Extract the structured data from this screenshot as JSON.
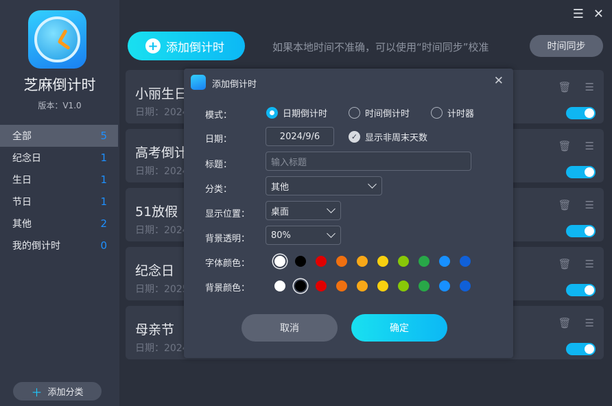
{
  "app": {
    "name": "芝麻倒计时",
    "version": "版本：V1.0"
  },
  "sidebar": {
    "items": [
      {
        "label": "全部",
        "count": "5"
      },
      {
        "label": "纪念日",
        "count": "1"
      },
      {
        "label": "生日",
        "count": "1"
      },
      {
        "label": "节日",
        "count": "1"
      },
      {
        "label": "其他",
        "count": "2"
      },
      {
        "label": "我的倒计时",
        "count": "0"
      }
    ],
    "add_category": "添加分类"
  },
  "header": {
    "add_label": "添加倒计时",
    "hint": "如果本地时间不准确，可以使用“时间同步”校准",
    "sync_label": "时间同步"
  },
  "cards": [
    {
      "title": "小丽生日",
      "date": "日期：2024"
    },
    {
      "title": "高考倒计",
      "date": "日期：2024"
    },
    {
      "title": "51放假",
      "date": "日期：2024"
    },
    {
      "title": "纪念日",
      "date": "日期：2025"
    },
    {
      "title": "母亲节",
      "date": "日期：2024"
    }
  ],
  "dialog": {
    "title": "添加倒计时",
    "mode_label": "模式：",
    "modes": [
      "日期倒计时",
      "时间倒计时",
      "计时器"
    ],
    "date_label": "日期：",
    "date_value": "2024/9/6",
    "show_nonweekend": "显示非周末天数",
    "title_label": "标题：",
    "title_placeholder": "输入标题",
    "category_label": "分类：",
    "category_value": "其他",
    "position_label": "显示位置：",
    "position_value": "桌面",
    "opacity_label": "背景透明：",
    "opacity_value": "80%",
    "font_color_label": "字体颜色：",
    "bg_color_label": "背景颜色：",
    "cancel": "取消",
    "confirm": "确定"
  },
  "colors": [
    "#ffffff",
    "#000000",
    "#e00000",
    "#f07010",
    "#f8a818",
    "#f8d010",
    "#88c808",
    "#28a848",
    "#1890ff",
    "#1060d8"
  ],
  "accent": "#0fb6f2"
}
